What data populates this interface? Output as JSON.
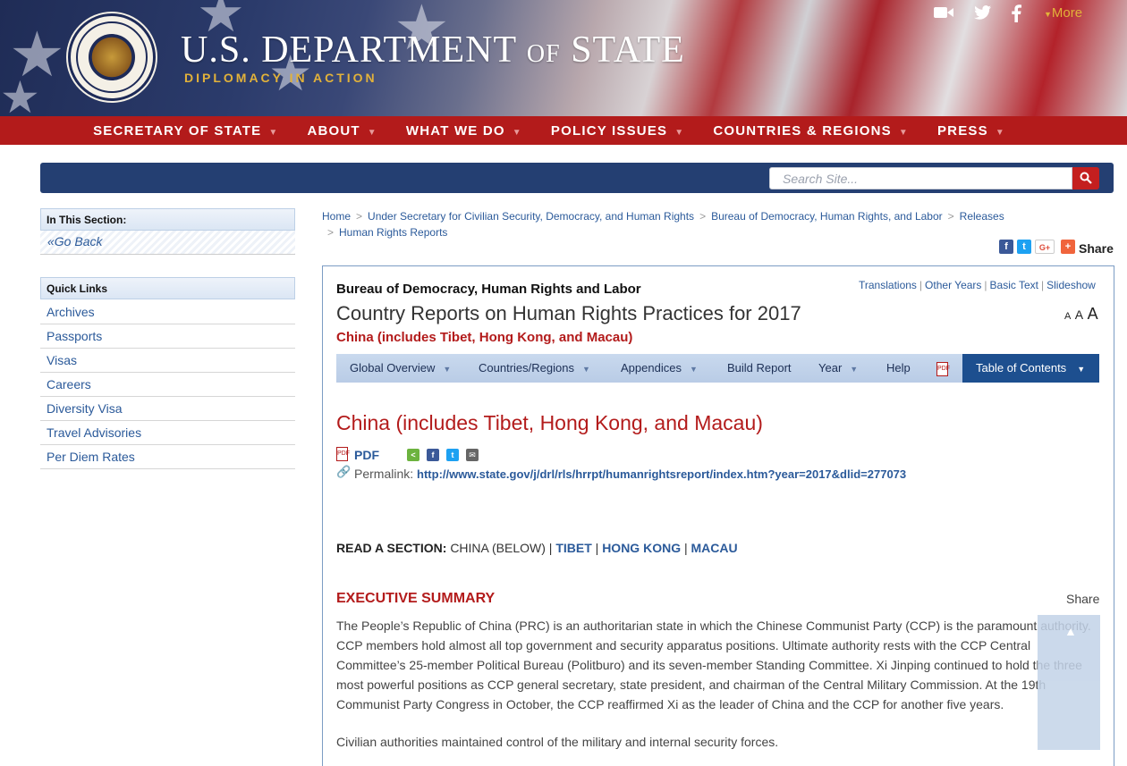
{
  "header": {
    "title_part1": "U.S. Department",
    "title_of": "of",
    "title_part2": "State",
    "tagline": "DIPLOMACY IN ACTION",
    "more_label": "More",
    "social_icons": [
      "video-icon",
      "twitter-icon",
      "facebook-icon"
    ]
  },
  "nav": {
    "items": [
      "SECRETARY OF STATE",
      "ABOUT",
      "WHAT WE DO",
      "POLICY ISSUES",
      "COUNTRIES & REGIONS",
      "PRESS"
    ]
  },
  "search": {
    "placeholder": "Search Site..."
  },
  "sidebar": {
    "in_this_section": "In This Section:",
    "go_back": "«Go Back",
    "quick_links_title": "Quick Links",
    "quick_links": [
      "Archives",
      "Passports",
      "Visas",
      "Careers",
      "Diversity Visa",
      "Travel Advisories",
      "Per Diem Rates"
    ]
  },
  "breadcrumb": {
    "items": [
      "Home",
      "Under Secretary for Civilian Security, Democracy, and Human Rights",
      "Bureau of Democracy, Human Rights, and Labor",
      "Releases",
      "Human Rights Reports"
    ],
    "sep": ">"
  },
  "share": {
    "label": "Share"
  },
  "report": {
    "bureau": "Bureau of Democracy, Human Rights and Labor",
    "title": "Country Reports on Human Rights Practices for 2017",
    "subtitle": "China (includes Tibet, Hong Kong, and Macau)",
    "top_links": [
      "Translations",
      "Other Years",
      "Basic Text",
      "Slideshow"
    ],
    "tabs": [
      "Global Overview",
      "Countries/Regions",
      "Appendices",
      "Build Report",
      "Year",
      "Help"
    ],
    "toc_label": "Table of Contents",
    "heading": "China (includes Tibet, Hong Kong, and Macau)",
    "pdf_label": "PDF",
    "permalink_label": "Permalink:",
    "permalink_url": "http://www.state.gov/j/drl/rls/hrrpt/humanrightsreport/index.htm?year=2017&dlid=277073",
    "read_section_label": "READ A SECTION:",
    "read_section_current": "CHINA (BELOW)",
    "read_section_links": [
      "TIBET",
      "HONG KONG",
      "MACAU"
    ],
    "exec_summary": "EXECUTIVE SUMMARY",
    "share_label": "Share",
    "paragraph1": "The People’s Republic of China (PRC) is an authoritarian state in which the Chinese Communist Party (CCP) is the paramount authority. CCP members hold almost all top government and security apparatus positions. Ultimate authority rests with the CCP Central Committee’s 25-member Political Bureau (Politburo) and its seven-member Standing Committee. Xi Jinping continued to hold the three most powerful positions as CCP general secretary, state president, and chairman of the Central Military Commission. At the 19th Communist Party Congress in October, the CCP reaffirmed Xi as the leader of China and the CCP for another five years.",
    "paragraph2": "Civilian authorities maintained control of the military and internal security forces."
  },
  "colors": {
    "brand_red": "#b31b1b",
    "navy": "#243f72",
    "link": "#2b5a9a",
    "gold": "#e2b23a"
  }
}
